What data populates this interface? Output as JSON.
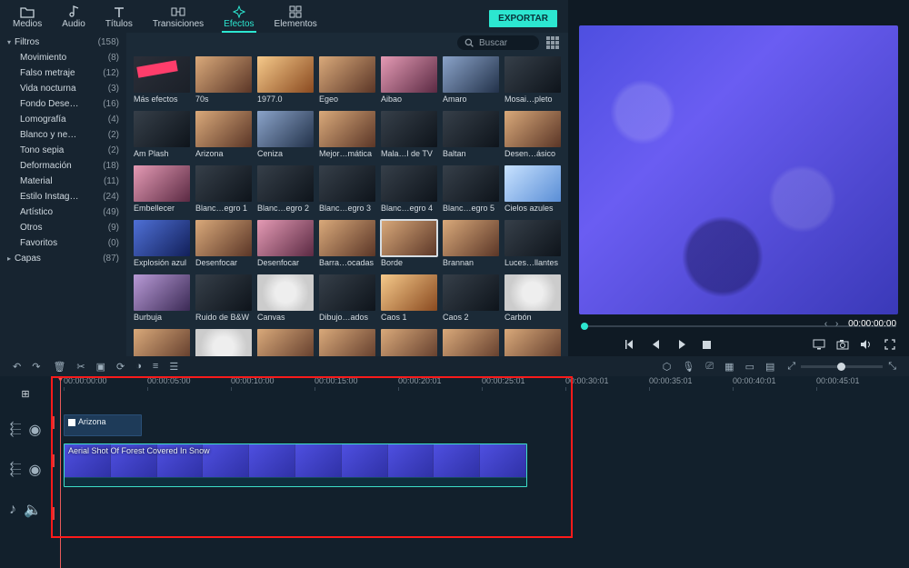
{
  "tabs": {
    "items": [
      {
        "label": "Medios",
        "icon": "folder-icon"
      },
      {
        "label": "Audio",
        "icon": "music-icon"
      },
      {
        "label": "Títulos",
        "icon": "text-icon"
      },
      {
        "label": "Transiciones",
        "icon": "transition-icon"
      },
      {
        "label": "Efectos",
        "icon": "sparkle-icon"
      },
      {
        "label": "Elementos",
        "icon": "elements-icon"
      }
    ],
    "active_index": 4,
    "export_label": "EXPORTAR"
  },
  "search": {
    "placeholder": "Buscar"
  },
  "categories": {
    "head1": {
      "label": "Filtros",
      "count": "(158)",
      "expanded": true
    },
    "subs": [
      {
        "label": "Movimiento",
        "count": "(8)"
      },
      {
        "label": "Falso metraje",
        "count": "(12)"
      },
      {
        "label": "Vida nocturna",
        "count": "(3)"
      },
      {
        "label": "Fondo Dese…",
        "count": "(16)"
      },
      {
        "label": "Lomografía",
        "count": "(4)"
      },
      {
        "label": "Blanco y ne…",
        "count": "(2)"
      },
      {
        "label": "Tono sepia",
        "count": "(2)"
      },
      {
        "label": "Deformación",
        "count": "(18)"
      },
      {
        "label": "Material",
        "count": "(11)"
      },
      {
        "label": "Estilo Instag…",
        "count": "(24)"
      },
      {
        "label": "Artístico",
        "count": "(49)"
      },
      {
        "label": "Otros",
        "count": "(9)"
      },
      {
        "label": "Favoritos",
        "count": "(0)"
      }
    ],
    "head2": {
      "label": "Capas",
      "count": "(87)",
      "expanded": false
    }
  },
  "effects": [
    {
      "label": "Más efectos",
      "tint": "t-promo"
    },
    {
      "label": "70s",
      "tint": "t-warm"
    },
    {
      "label": "1977.0",
      "tint": "t-orange"
    },
    {
      "label": "Egeo",
      "tint": "t-warm"
    },
    {
      "label": "Aibao",
      "tint": "t-pink"
    },
    {
      "label": "Amaro",
      "tint": "t-cool"
    },
    {
      "label": "Mosai…pleto",
      "tint": "t-dark"
    },
    {
      "label": "Am Plash",
      "tint": "t-dark"
    },
    {
      "label": "Arizona",
      "tint": "t-warm"
    },
    {
      "label": "Ceniza",
      "tint": "t-cool"
    },
    {
      "label": "Mejor…mática",
      "tint": "t-warm"
    },
    {
      "label": "Mala…l de TV",
      "tint": "t-dark"
    },
    {
      "label": "Baltan",
      "tint": "t-dark"
    },
    {
      "label": "Desen…ásico",
      "tint": "t-warm"
    },
    {
      "label": "Embellecer",
      "tint": "t-pink"
    },
    {
      "label": "Blanc…egro 1",
      "tint": "t-dark"
    },
    {
      "label": "Blanc…egro 2",
      "tint": "t-dark"
    },
    {
      "label": "Blanc…egro 3",
      "tint": "t-dark"
    },
    {
      "label": "Blanc…egro 4",
      "tint": "t-dark"
    },
    {
      "label": "Blanc…egro 5",
      "tint": "t-dark"
    },
    {
      "label": "Cielos azules",
      "tint": "t-sky"
    },
    {
      "label": "Explosión azul",
      "tint": "t-blue"
    },
    {
      "label": "Desenfocar",
      "tint": "t-warm"
    },
    {
      "label": "Desenfocar",
      "tint": "t-pink"
    },
    {
      "label": "Barra…ocadas",
      "tint": "t-warm"
    },
    {
      "label": "Borde",
      "tint": "t-warm",
      "selected": true
    },
    {
      "label": "Brannan",
      "tint": "t-warm"
    },
    {
      "label": "Luces…llantes",
      "tint": "t-dark"
    },
    {
      "label": "Burbuja",
      "tint": "t-purple"
    },
    {
      "label": "Ruido de B&W",
      "tint": "t-dark"
    },
    {
      "label": "Canvas",
      "tint": "t-white"
    },
    {
      "label": "Dibujo…ados",
      "tint": "t-dark"
    },
    {
      "label": "Caos 1",
      "tint": "t-orange"
    },
    {
      "label": "Caos 2",
      "tint": "t-dark"
    },
    {
      "label": "Carbón",
      "tint": "t-white"
    },
    {
      "label": "",
      "tint": "t-warm"
    },
    {
      "label": "",
      "tint": "t-white"
    },
    {
      "label": "",
      "tint": "t-warm"
    },
    {
      "label": "",
      "tint": "t-warm"
    },
    {
      "label": "",
      "tint": "t-warm"
    },
    {
      "label": "",
      "tint": "t-warm"
    },
    {
      "label": "",
      "tint": "t-warm"
    }
  ],
  "preview": {
    "time_current": "00:00:00:00",
    "time_total": "00:00:00:00"
  },
  "timeline": {
    "ticks": [
      "00:00:00:00",
      "00:00:05:00",
      "00:00:10:00",
      "00:00:15:00",
      "00:00:20:01",
      "00:00:25:01",
      "00:00:30:01",
      "00:00:35:01",
      "00:00:40:01",
      "00:00:45:01"
    ],
    "fx_clip": {
      "label": "Arizona"
    },
    "vid_clip": {
      "label": "Aerial Shot Of Forest Covered In Snow"
    }
  }
}
